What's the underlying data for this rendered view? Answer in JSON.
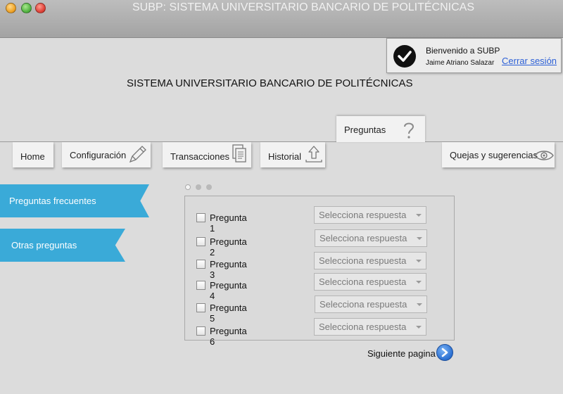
{
  "window": {
    "title": "SUBP: SISTEMA UNIVERSITARIO BANCARIO DE POLITÉCNICAS"
  },
  "welcome": {
    "greeting": "Bienvenido a SUBP",
    "user": "Jaime Atriano Salazar",
    "logout": "Cerrar sesión"
  },
  "heading": "SISTEMA UNIVERSITARIO BANCARIO DE POLITÉCNICAS",
  "nav": {
    "preguntas": "Preguntas",
    "home": "Home",
    "configuracion": "Configuración",
    "transacciones": "Transacciones",
    "historial": "Historial",
    "quejas": "Quejas y sugerencias"
  },
  "sidebar": {
    "items": [
      {
        "label": "Preguntas frecuentes"
      },
      {
        "label": "Otras preguntas"
      }
    ]
  },
  "questions": [
    {
      "label": "Pregunta 1",
      "answer": "Selecciona respuesta"
    },
    {
      "label": "Pregunta 2",
      "answer": "Selecciona respuesta"
    },
    {
      "label": "Pregunta 3",
      "answer": "Selecciona respuesta"
    },
    {
      "label": "Pregunta 4",
      "answer": "Selecciona respuesta"
    },
    {
      "label": "Pregunta 5",
      "answer": "Selecciona respuesta"
    },
    {
      "label": "Pregunta 6",
      "answer": "Selecciona respuesta"
    }
  ],
  "next_page": "Siguiente pagina",
  "colors": {
    "sidebar": "#3aaad8",
    "link": "#2b5fd6",
    "next_button": "#2a6fd1"
  }
}
